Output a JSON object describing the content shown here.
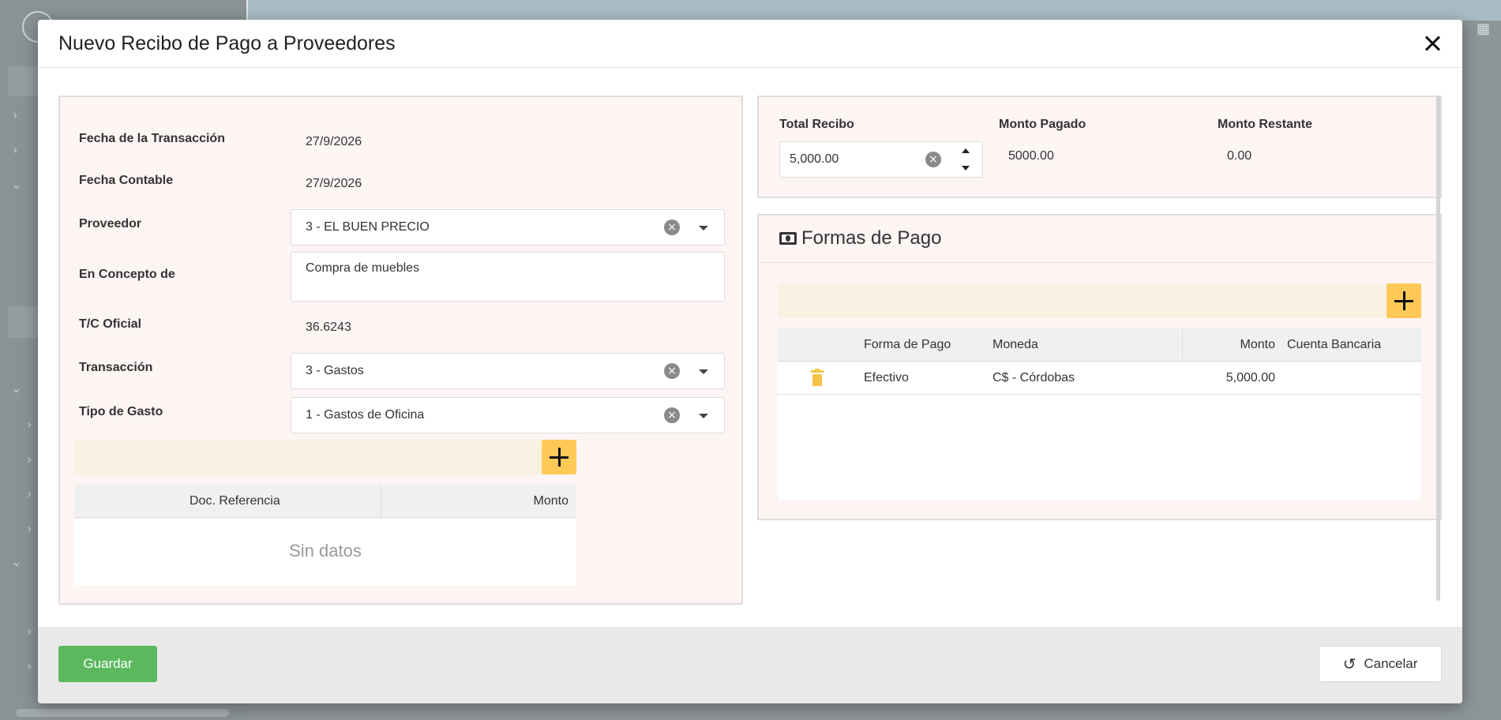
{
  "modal": {
    "title": "Nuevo Recibo de Pago a Proveedores",
    "close_icon": "close-icon"
  },
  "form": {
    "fecha_transaccion": {
      "label": "Fecha de la Transacción",
      "value": "27/9/2026"
    },
    "fecha_contable": {
      "label": "Fecha Contable",
      "value": "27/9/2026"
    },
    "proveedor": {
      "label": "Proveedor",
      "value": "3 - EL BUEN PRECIO"
    },
    "concepto": {
      "label": "En Concepto de",
      "value": "Compra de muebles"
    },
    "tc_oficial": {
      "label": "T/C Oficial",
      "value": "36.6243"
    },
    "transaccion": {
      "label": "Transacción",
      "value": "3 - Gastos"
    },
    "tipo_gasto": {
      "label": "Tipo de Gasto",
      "value": "1 - Gastos de Oficina"
    }
  },
  "documents_grid": {
    "columns": [
      "Doc. Referencia",
      "Monto"
    ],
    "empty_text": "Sin datos"
  },
  "totals": {
    "total_recibo": {
      "label": "Total Recibo",
      "value": "5,000.00"
    },
    "monto_pagado": {
      "label": "Monto Pagado",
      "value": "5000.00"
    },
    "monto_restante": {
      "label": "Monto Restante",
      "value": "0.00"
    }
  },
  "payments": {
    "title": "Formas de Pago",
    "columns": [
      "Forma de Pago",
      "Moneda",
      "Monto",
      "Cuenta Bancaria"
    ],
    "rows": [
      {
        "forma": "Efectivo",
        "moneda": "C$ - Córdobas",
        "monto": "5,000.00",
        "cuenta": ""
      }
    ]
  },
  "footer": {
    "save_label": "Guardar",
    "cancel_label": "Cancelar"
  },
  "colors": {
    "accent_yellow": "#ffc958",
    "save_green": "#5cb85c",
    "panel_bg": "#fdf4f4",
    "strip_bg": "#f7f2e1"
  }
}
